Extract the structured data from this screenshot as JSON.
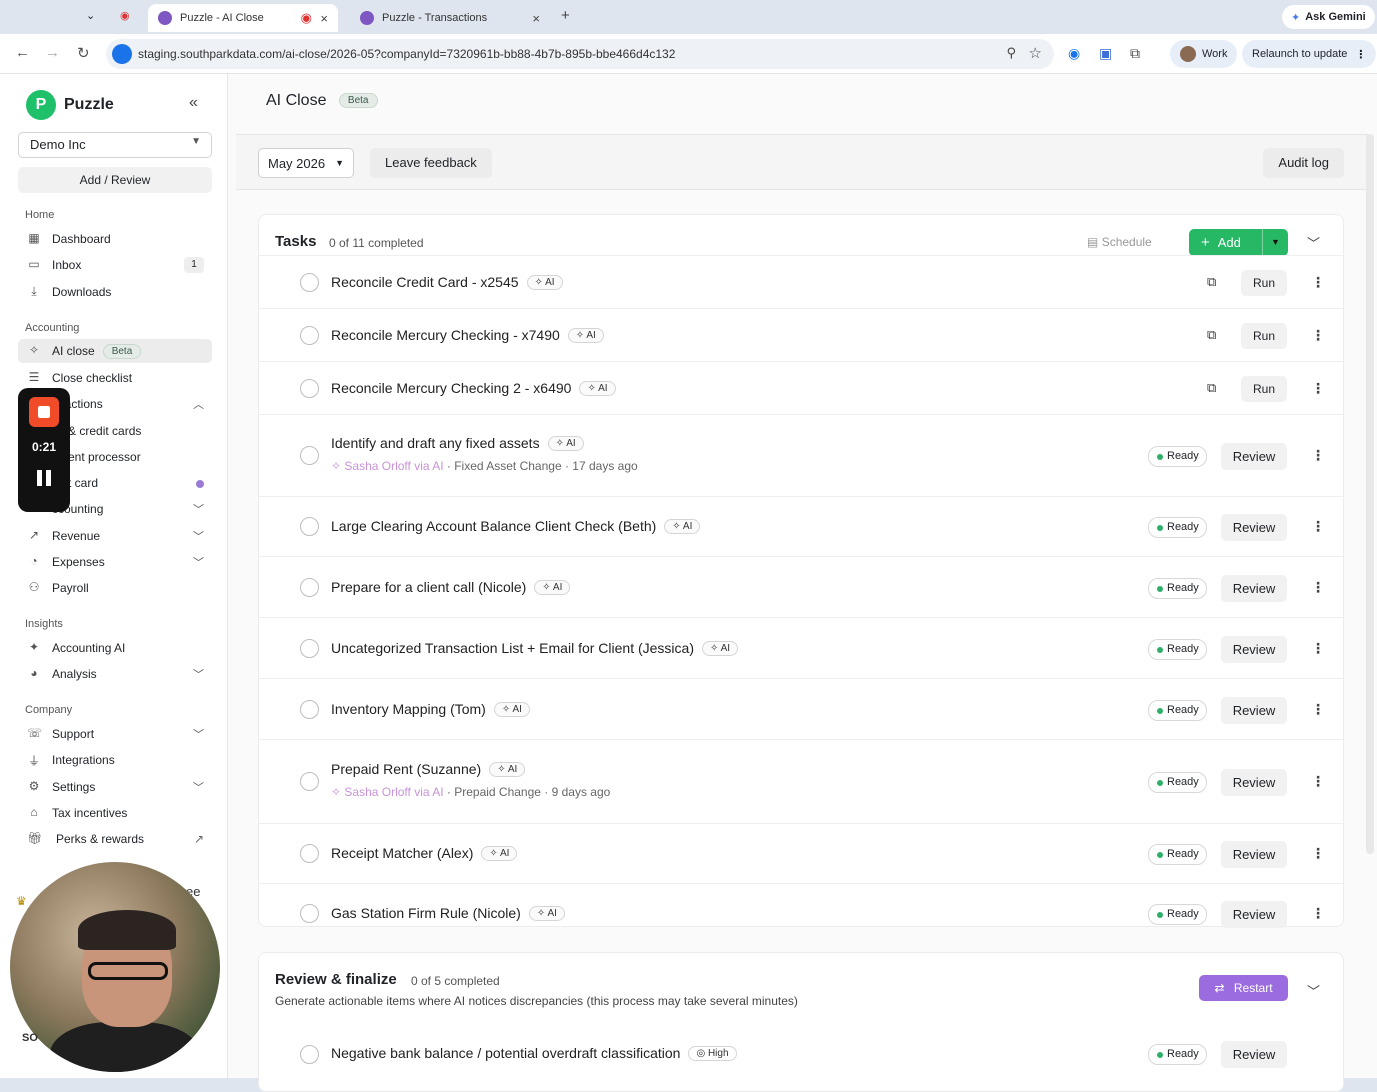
{
  "browser": {
    "tabs": [
      {
        "title": "Puzzle - AI Close",
        "active": true
      },
      {
        "title": "Puzzle - Transactions",
        "active": false
      }
    ],
    "url": "staging.southparkdata.com/ai-close/2026-05?companyId=7320961b-bb88-4b7b-895b-bbe466d4c132",
    "profile": "Work",
    "relaunch": "Relaunch to update",
    "ask_gemini": "Ask Gemini"
  },
  "sidebar": {
    "brand": "Puzzle",
    "company": "Demo Inc",
    "add_review": "Add / Review",
    "sections": {
      "home": "Home",
      "accounting": "Accounting",
      "insights": "Insights",
      "company": "Company"
    },
    "home_items": [
      {
        "label": "Dashboard",
        "icon": "grid-icon"
      },
      {
        "label": "Inbox",
        "icon": "inbox-icon",
        "count": "1"
      },
      {
        "label": "Downloads",
        "icon": "download-icon"
      }
    ],
    "accounting_items": [
      {
        "label": "AI close",
        "badge": "Beta",
        "active": true
      },
      {
        "label": "Close checklist"
      },
      {
        "label": "nsactions"
      },
      {
        "label": "nk & credit cards"
      },
      {
        "label": "yment processor"
      },
      {
        "label": "edit card"
      },
      {
        "label": "ccounting"
      },
      {
        "label": "Revenue"
      },
      {
        "label": "Expenses"
      },
      {
        "label": "Payroll"
      }
    ],
    "insights_items": [
      {
        "label": "Accounting AI"
      },
      {
        "label": "Analysis"
      }
    ],
    "company_items": [
      {
        "label": "Support"
      },
      {
        "label": "Integrations"
      },
      {
        "label": "Settings"
      },
      {
        "label": "Tax incentives"
      },
      {
        "label": "Perks & rewards"
      }
    ],
    "recorder_time": "0:21",
    "avatar_initials": "SO",
    "partial_label": "ee"
  },
  "main": {
    "title": "AI Close",
    "title_badge": "Beta",
    "period": "May 2026",
    "feedback": "Leave feedback",
    "audit_log": "Audit log"
  },
  "tasks": {
    "title": "Tasks",
    "progress": "0 of 11 completed",
    "schedule": "Schedule",
    "add": "Add",
    "items": [
      {
        "title": "Reconcile Credit Card - x2545",
        "tag": "AI",
        "action": "Run"
      },
      {
        "title": "Reconcile Mercury Checking - x7490",
        "tag": "AI",
        "action": "Run"
      },
      {
        "title": "Reconcile Mercury Checking 2 - x6490",
        "tag": "AI",
        "action": "Run"
      },
      {
        "title": "Identify and draft any fixed assets",
        "tag": "AI",
        "status": "Ready",
        "action": "Review",
        "via": "Sasha Orloff via AI",
        "meta": " · Fixed Asset Change · 17 days ago"
      },
      {
        "title": "Large Clearing Account Balance Client Check (Beth)",
        "tag": "AI",
        "status": "Ready",
        "action": "Review"
      },
      {
        "title": "Prepare for a client call (Nicole)",
        "tag": "AI",
        "status": "Ready",
        "action": "Review"
      },
      {
        "title": "Uncategorized Transaction List + Email for Client (Jessica)",
        "tag": "AI",
        "status": "Ready",
        "action": "Review"
      },
      {
        "title": "Inventory Mapping (Tom)",
        "tag": "AI",
        "status": "Ready",
        "action": "Review"
      },
      {
        "title": "Prepaid Rent (Suzanne)",
        "tag": "AI",
        "status": "Ready",
        "action": "Review",
        "via": "Sasha Orloff via AI",
        "meta": " · Prepaid Change · 9 days ago"
      },
      {
        "title": "Receipt Matcher (Alex)",
        "tag": "AI",
        "status": "Ready",
        "action": "Review"
      },
      {
        "title": "Gas Station Firm Rule (Nicole)",
        "tag": "AI",
        "status": "Ready",
        "action": "Review"
      }
    ]
  },
  "review_finalize": {
    "title": "Review & finalize",
    "progress": "0 of 5 completed",
    "description": "Generate actionable items where AI notices discrepancies (this process may take several minutes)",
    "restart": "Restart",
    "items": [
      {
        "title": "Negative bank balance / potential overdraft classification",
        "tag": "High",
        "status": "Ready",
        "action": "Review"
      }
    ]
  },
  "colors": {
    "brand_green": "#1fc06a",
    "add_green": "#27b866",
    "restart_purple": "#9b6ce0",
    "recorder_red": "#f04c2a"
  }
}
